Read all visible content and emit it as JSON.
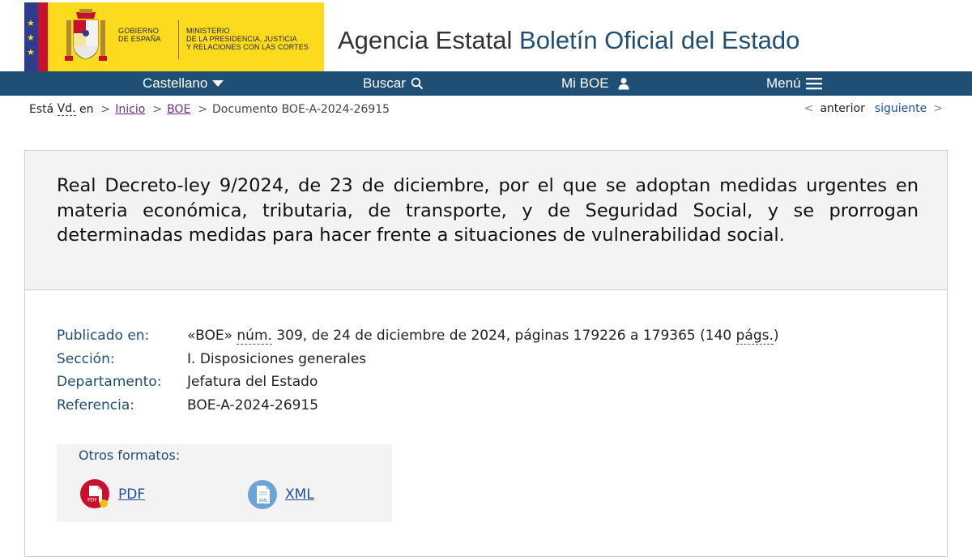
{
  "header": {
    "gov_line1": "GOBIERNO",
    "gov_line2": "DE ESPAÑA",
    "ministry_line1": "MINISTERIO",
    "ministry_line2": "DE LA PRESIDENCIA, JUSTICIA",
    "ministry_line3": "Y RELACIONES CON LAS CORTES",
    "agency_prefix": "Agencia Estatal",
    "agency_name": "Boletín Oficial del Estado",
    "flag_stars": [
      "★",
      "★",
      "★"
    ]
  },
  "nav": {
    "language": "Castellano",
    "search": "Buscar",
    "my_boe": "Mi BOE",
    "menu": "Menú"
  },
  "breadcrumb": {
    "intro_prefix": "Está",
    "intro_abbr": "Vd.",
    "intro_suffix": "en",
    "separator": ">",
    "home": "Inicio",
    "boe": "BOE",
    "current": "Documento BOE-A-2024-26915"
  },
  "pager": {
    "prev_chevron": "<",
    "prev": "anterior",
    "next": "siguiente",
    "next_chevron": ">"
  },
  "document": {
    "title": "Real Decreto-ley 9/2024, de 23 de diciembre, por el que se adoptan medidas urgentes en materia económica, tributaria, de transporte, y de Seguridad Social, y se prorrogan determinadas medidas para hacer frente a situaciones de vulnerabilidad social.",
    "published_label": "Publicado en:",
    "published_boe": "«BOE»",
    "published_num_abbr": "núm.",
    "published_mid": "309, de 24 de diciembre de 2024, páginas 179226 a 179365 (140",
    "published_pags_abbr": "págs.",
    "published_end": ")",
    "section_label": "Sección:",
    "section_value": "I. Disposiciones generales",
    "department_label": "Departamento:",
    "department_value": "Jefatura del Estado",
    "reference_label": "Referencia:",
    "reference_value": "BOE-A-2024-26915"
  },
  "formats": {
    "label": "Otros formatos:",
    "pdf": "PDF",
    "xml": "XML",
    "pdf_icon_text": "PDF",
    "xml_icon_text": "XML"
  },
  "colors": {
    "navy": "#1f4f75",
    "yellow": "#fcdb1e",
    "link": "#1f4f9c",
    "visited": "#6b2b8c",
    "pdf_red": "#c8102e",
    "xml_blue": "#6aa3d5"
  }
}
